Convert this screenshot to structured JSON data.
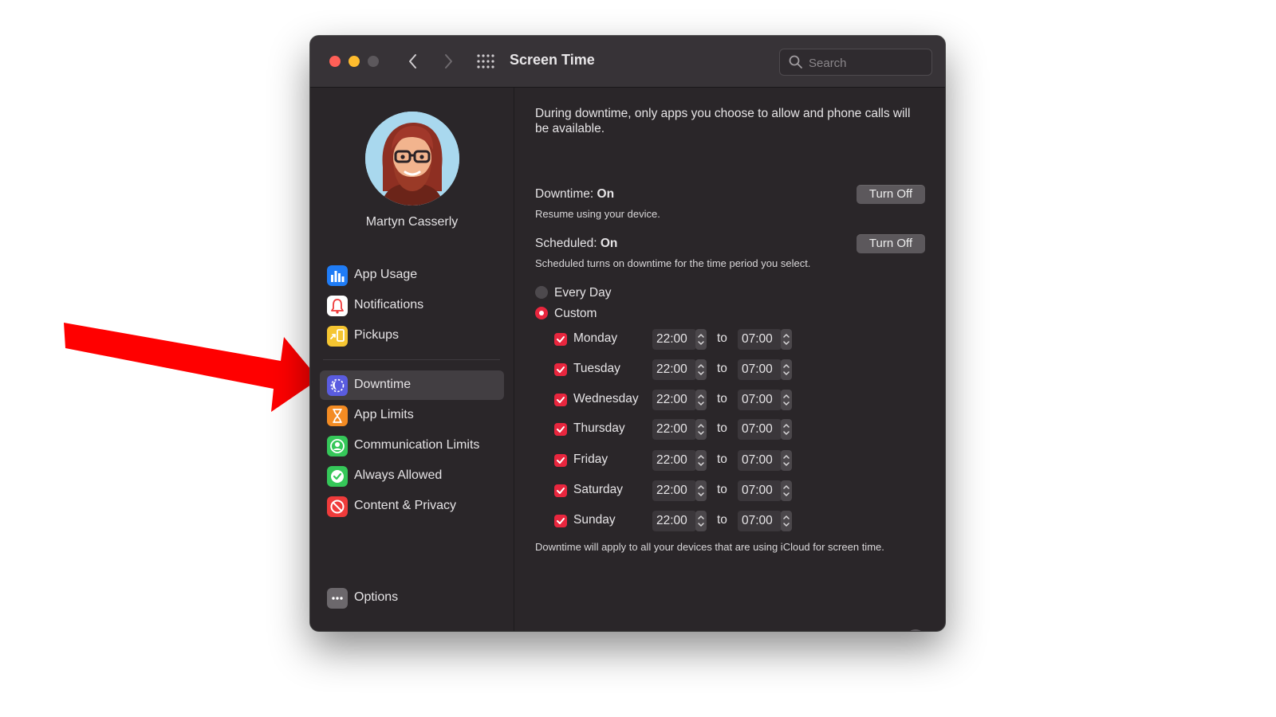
{
  "window": {
    "title": "Screen Time",
    "search_placeholder": "Search"
  },
  "sidebar": {
    "user_name": "Martyn Casserly",
    "items_top": [
      {
        "label": "App Usage",
        "icon": "bar-chart-icon",
        "color": "#1f7cf6"
      },
      {
        "label": "Notifications",
        "icon": "bell-icon",
        "color": "#ffffff"
      },
      {
        "label": "Pickups",
        "icon": "pickups-icon",
        "color": "#f5c531"
      }
    ],
    "items_bottom": [
      {
        "label": "Downtime",
        "icon": "downtime-icon",
        "color": "#5a5ce0",
        "selected": true
      },
      {
        "label": "App Limits",
        "icon": "hourglass-icon",
        "color": "#f38b23"
      },
      {
        "label": "Communication Limits",
        "icon": "person-icon",
        "color": "#35c759"
      },
      {
        "label": "Always Allowed",
        "icon": "checkmark-badge-icon",
        "color": "#35c759"
      },
      {
        "label": "Content & Privacy",
        "icon": "no-entry-icon",
        "color": "#ef3b3b"
      }
    ],
    "options_label": "Options"
  },
  "content": {
    "intro": "During downtime, only apps you choose to allow and phone calls will be available.",
    "downtime": {
      "label": "Downtime:",
      "value": "On",
      "note": "Resume using your device.",
      "button": "Turn Off"
    },
    "scheduled": {
      "label": "Scheduled:",
      "value": "On",
      "note": "Scheduled turns on downtime for the time period you select.",
      "button": "Turn Off"
    },
    "schedule_options": [
      {
        "label": "Every Day",
        "selected": false
      },
      {
        "label": "Custom",
        "selected": true
      }
    ],
    "to_label": "to",
    "days": [
      {
        "day": "Monday",
        "checked": true,
        "from": "22:00",
        "to": "07:00"
      },
      {
        "day": "Tuesday",
        "checked": true,
        "from": "22:00",
        "to": "07:00"
      },
      {
        "day": "Wednesday",
        "checked": true,
        "from": "22:00",
        "to": "07:00"
      },
      {
        "day": "Thursday",
        "checked": true,
        "from": "22:00",
        "to": "07:00"
      },
      {
        "day": "Friday",
        "checked": true,
        "from": "22:00",
        "to": "07:00"
      },
      {
        "day": "Saturday",
        "checked": true,
        "from": "22:00",
        "to": "07:00"
      },
      {
        "day": "Sunday",
        "checked": true,
        "from": "22:00",
        "to": "07:00"
      }
    ],
    "footnote": "Downtime will apply to all your devices that are using iCloud for screen time.",
    "help_label": "?"
  },
  "colors": {
    "accent": "#e8263e",
    "arrow": "#ff0000",
    "window_bg": "#2a2629"
  }
}
